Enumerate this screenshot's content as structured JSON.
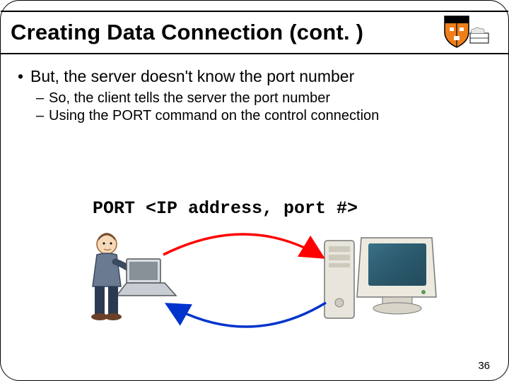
{
  "title": "Creating Data Connection (cont. )",
  "bullets": {
    "main": "But, the server doesn't know the port number",
    "sub1": "So, the client tells the server the port number",
    "sub2": "Using the PORT command on the control connection"
  },
  "port_command": "PORT <IP address, port #>",
  "page_number": "36",
  "icons": {
    "client": "person-at-laptop-icon",
    "server": "desktop-tower-monitor-icon",
    "logo": "princeton-shield-icon"
  },
  "arrows": {
    "top_color": "#ff0000",
    "bottom_color": "#0033cc"
  }
}
